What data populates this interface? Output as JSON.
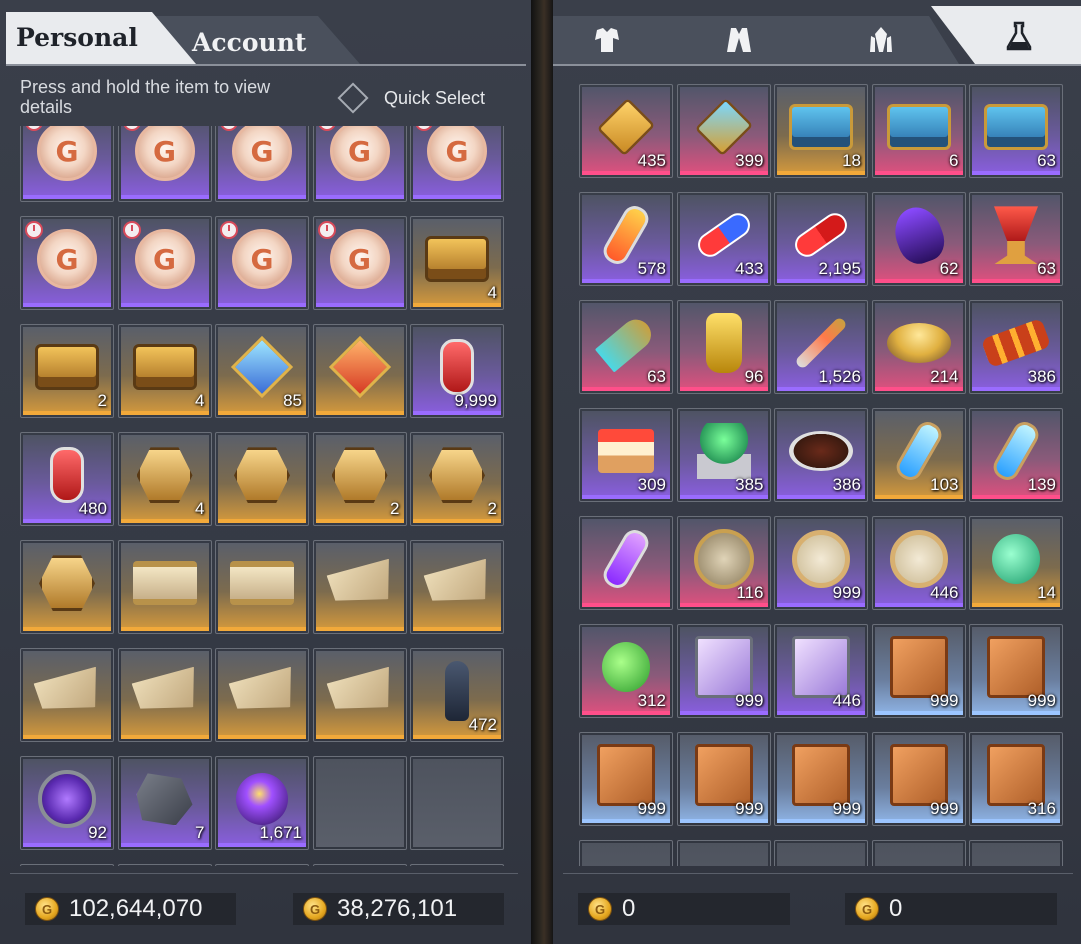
{
  "left_panel": {
    "tabs": {
      "personal": "Personal",
      "account": "Account"
    },
    "hint": "Press and hold the item to view details",
    "quick_select": "Quick Select",
    "currencies": [
      {
        "icon": "gold-coin-icon",
        "value": "102,644,070"
      },
      {
        "icon": "bound-gold-coin-icon",
        "value": "38,276,101"
      }
    ],
    "items": [
      {
        "icon": "coupon-coin",
        "rarity": "purple",
        "qty": "",
        "timer": true
      },
      {
        "icon": "coupon-coin",
        "rarity": "purple",
        "qty": "",
        "timer": true
      },
      {
        "icon": "coupon-coin",
        "rarity": "purple",
        "qty": "",
        "timer": true
      },
      {
        "icon": "coupon-coin",
        "rarity": "purple",
        "qty": "",
        "timer": true
      },
      {
        "icon": "coupon-coin",
        "rarity": "purple",
        "qty": "",
        "timer": true
      },
      {
        "icon": "coupon-coin",
        "rarity": "purple",
        "qty": "",
        "timer": true
      },
      {
        "icon": "coupon-coin",
        "rarity": "purple",
        "qty": "",
        "timer": true
      },
      {
        "icon": "coupon-coin",
        "rarity": "purple",
        "qty": "",
        "timer": true
      },
      {
        "icon": "coupon-coin",
        "rarity": "purple",
        "qty": "",
        "timer": true
      },
      {
        "icon": "gold-chest",
        "rarity": "gold",
        "qty": "4",
        "timer": false
      },
      {
        "icon": "gold-chest",
        "rarity": "gold",
        "qty": "2",
        "timer": false
      },
      {
        "icon": "gold-chest",
        "rarity": "gold",
        "qty": "4",
        "timer": false
      },
      {
        "icon": "blue-gem",
        "rarity": "gold",
        "qty": "85",
        "timer": false
      },
      {
        "icon": "orange-gem",
        "rarity": "gold",
        "qty": "",
        "timer": false
      },
      {
        "icon": "red-potion",
        "rarity": "purple",
        "qty": "9,999",
        "timer": false
      },
      {
        "icon": "red-potion",
        "rarity": "purple",
        "qty": "480",
        "timer": false
      },
      {
        "icon": "gold-badge",
        "rarity": "gold",
        "qty": "4",
        "timer": false
      },
      {
        "icon": "gold-badge",
        "rarity": "gold",
        "qty": "",
        "timer": false
      },
      {
        "icon": "gold-badge",
        "rarity": "gold",
        "qty": "2",
        "timer": false
      },
      {
        "icon": "gold-badge",
        "rarity": "gold",
        "qty": "2",
        "timer": false
      },
      {
        "icon": "gold-badge",
        "rarity": "gold",
        "qty": "",
        "timer": false
      },
      {
        "icon": "scroll",
        "rarity": "gold",
        "qty": "",
        "timer": false
      },
      {
        "icon": "scroll",
        "rarity": "gold",
        "qty": "",
        "timer": false
      },
      {
        "icon": "map",
        "rarity": "gold",
        "qty": "",
        "timer": false
      },
      {
        "icon": "map",
        "rarity": "gold",
        "qty": "",
        "timer": false
      },
      {
        "icon": "map",
        "rarity": "gold",
        "qty": "",
        "timer": false
      },
      {
        "icon": "map",
        "rarity": "gold",
        "qty": "",
        "timer": false
      },
      {
        "icon": "map",
        "rarity": "gold",
        "qty": "",
        "timer": false
      },
      {
        "icon": "map",
        "rarity": "gold",
        "qty": "",
        "timer": false
      },
      {
        "icon": "chess-pawn",
        "rarity": "gold",
        "qty": "472",
        "timer": false
      },
      {
        "icon": "portal-stone",
        "rarity": "purple",
        "qty": "92",
        "timer": false
      },
      {
        "icon": "lightning-rock",
        "rarity": "purple",
        "qty": "7",
        "timer": false
      },
      {
        "icon": "star-orb",
        "rarity": "purple",
        "qty": "1,671",
        "timer": false
      },
      {
        "icon": "",
        "rarity": "empty",
        "qty": "",
        "timer": false
      },
      {
        "icon": "",
        "rarity": "empty",
        "qty": "",
        "timer": false
      }
    ]
  },
  "right_panel": {
    "tabs": [
      {
        "icon": "armor-icon",
        "active": false
      },
      {
        "icon": "jacket-icon",
        "active": false
      },
      {
        "icon": "crystal-icon",
        "active": false
      },
      {
        "icon": "flask-icon",
        "active": true
      }
    ],
    "currencies": [
      {
        "icon": "gold-coin-icon",
        "value": "0"
      },
      {
        "icon": "bound-gold-coin-icon",
        "value": "0"
      }
    ],
    "items": [
      {
        "icon": "gold-cage",
        "rarity": "pink",
        "qty": "435"
      },
      {
        "icon": "blue-cage",
        "rarity": "pink",
        "qty": "399"
      },
      {
        "icon": "blue-chest",
        "rarity": "gold",
        "qty": "18"
      },
      {
        "icon": "blue-chest",
        "rarity": "pink",
        "qty": "6"
      },
      {
        "icon": "blue-chest",
        "rarity": "purple",
        "qty": "63"
      },
      {
        "icon": "orange-tube",
        "rarity": "purple",
        "qty": "578"
      },
      {
        "icon": "capsule",
        "rarity": "purple",
        "qty": "433"
      },
      {
        "icon": "red-capsule",
        "rarity": "purple",
        "qty": "2,195"
      },
      {
        "icon": "dark-shell",
        "rarity": "pink",
        "qty": "62"
      },
      {
        "icon": "red-goblet",
        "rarity": "pink",
        "qty": "63"
      },
      {
        "icon": "horn-flask",
        "rarity": "pink",
        "qty": "63"
      },
      {
        "icon": "gold-vase",
        "rarity": "pink",
        "qty": "96"
      },
      {
        "icon": "syringe",
        "rarity": "purple",
        "qty": "1,526"
      },
      {
        "icon": "soup-bowl",
        "rarity": "pink",
        "qty": "214"
      },
      {
        "icon": "skewer",
        "rarity": "purple",
        "qty": "386"
      },
      {
        "icon": "cake",
        "rarity": "purple",
        "qty": "309"
      },
      {
        "icon": "salad",
        "rarity": "purple",
        "qty": "385"
      },
      {
        "icon": "steak",
        "rarity": "purple",
        "qty": "386"
      },
      {
        "icon": "cyan-tube",
        "rarity": "gold",
        "qty": "103"
      },
      {
        "icon": "cyan-tube",
        "rarity": "pink",
        "qty": "139"
      },
      {
        "icon": "purple-tube",
        "rarity": "pink",
        "qty": ""
      },
      {
        "icon": "astrolabe",
        "rarity": "pink",
        "qty": "116"
      },
      {
        "icon": "compass",
        "rarity": "purple",
        "qty": "999"
      },
      {
        "icon": "compass",
        "rarity": "purple",
        "qty": "446"
      },
      {
        "icon": "teal-fruit",
        "rarity": "gold",
        "qty": "14"
      },
      {
        "icon": "green-fruit",
        "rarity": "pink",
        "qty": "312"
      },
      {
        "icon": "purple-book",
        "rarity": "purple",
        "qty": "999"
      },
      {
        "icon": "purple-book",
        "rarity": "purple",
        "qty": "446"
      },
      {
        "icon": "orange-book",
        "rarity": "blue",
        "qty": "999"
      },
      {
        "icon": "orange-book",
        "rarity": "blue",
        "qty": "999"
      },
      {
        "icon": "orange-book",
        "rarity": "blue",
        "qty": "999"
      },
      {
        "icon": "orange-book",
        "rarity": "blue",
        "qty": "999"
      },
      {
        "icon": "orange-book",
        "rarity": "blue",
        "qty": "999"
      },
      {
        "icon": "orange-book",
        "rarity": "blue",
        "qty": "999"
      },
      {
        "icon": "orange-book",
        "rarity": "blue",
        "qty": "316"
      }
    ]
  }
}
